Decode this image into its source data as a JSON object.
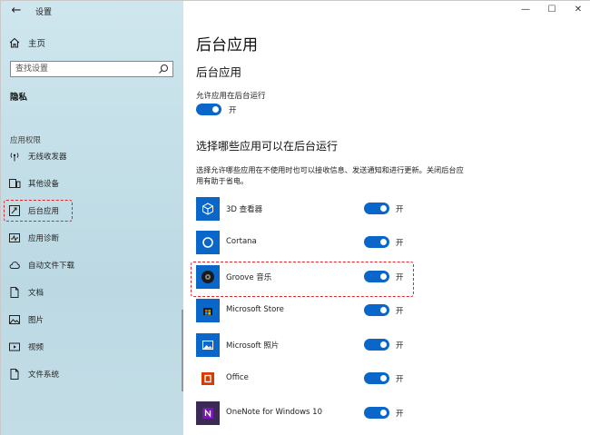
{
  "window": {
    "title": "设置",
    "back_glyph": "←",
    "minimize_glyph": "—",
    "maximize_glyph": "☐",
    "close_glyph": "✕"
  },
  "sidebar": {
    "home_label": "主页",
    "search_placeholder": "查找设置",
    "section": "隐私",
    "group_label": "应用权限",
    "items": [
      {
        "label": "无线收发器",
        "icon": "radio-icon"
      },
      {
        "label": "其他设备",
        "icon": "devices-icon"
      },
      {
        "label": "后台应用",
        "icon": "background-apps-icon",
        "selected": true
      },
      {
        "label": "应用诊断",
        "icon": "diagnostics-icon"
      },
      {
        "label": "自动文件下载",
        "icon": "cloud-icon"
      },
      {
        "label": "文档",
        "icon": "document-icon"
      },
      {
        "label": "图片",
        "icon": "picture-icon"
      },
      {
        "label": "视频",
        "icon": "video-icon"
      },
      {
        "label": "文件系统",
        "icon": "file-system-icon"
      }
    ]
  },
  "main": {
    "page_title": "后台应用",
    "sub_title": "后台应用",
    "allow_label": "允许应用在后台运行",
    "allow_state": "开",
    "choose_title": "选择哪些应用可以在后台运行",
    "description": "选择允许哪些应用在不使用时也可以接收信息、发送通知和进行更新。关闭后台应用有助于省电。",
    "apps": [
      {
        "name": "3D 查看器",
        "state": "开",
        "icon": "3d-viewer-icon",
        "color": "#0a66c8"
      },
      {
        "name": "Cortana",
        "state": "开",
        "icon": "cortana-icon",
        "color": "#0a66c8"
      },
      {
        "name": "Groove 音乐",
        "state": "开",
        "icon": "groove-music-icon",
        "color": "#0a66c8"
      },
      {
        "name": "Microsoft Store",
        "state": "开",
        "icon": "store-icon",
        "color": "#0a66c8"
      },
      {
        "name": "Microsoft 照片",
        "state": "开",
        "icon": "photos-icon",
        "color": "#0a66c8"
      },
      {
        "name": "Office",
        "state": "开",
        "icon": "office-icon",
        "color": "#d83b01"
      },
      {
        "name": "OneNote for Windows 10",
        "state": "开",
        "icon": "onenote-icon",
        "color": "#7719aa"
      }
    ]
  },
  "colors": {
    "accent": "#0a66c8",
    "highlight": "#e0242a"
  }
}
